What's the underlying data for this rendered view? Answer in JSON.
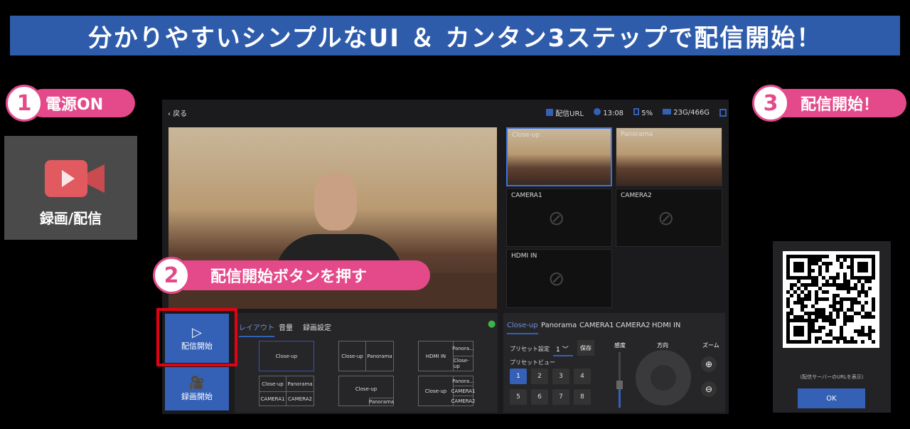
{
  "banner": {
    "title": "分かりやすいシンプルなUI ＆ カンタン3ステップで配信開始！"
  },
  "steps": [
    {
      "num": "1",
      "label": "電源ON"
    },
    {
      "num": "2",
      "label": "配信開始ボタンを押す"
    },
    {
      "num": "3",
      "label": "配信開始！"
    }
  ],
  "power_panel": {
    "label": "録画/配信",
    "icon": "video-camera-icon",
    "icon_color": "#e05a5f"
  },
  "app": {
    "back_label": "戻る",
    "status": {
      "stream_url": "配信URL",
      "time": "13:08",
      "battery": "5%",
      "storage": "23G/466G"
    },
    "tiles": [
      {
        "label": "Close-up",
        "selected": true
      },
      {
        "label": "Panorama"
      },
      {
        "label": "CAMERA1"
      },
      {
        "label": "CAMERA2"
      },
      {
        "label": "HDMI IN"
      }
    ],
    "buttons": {
      "stream": "配信開始",
      "record": "録画開始"
    },
    "layout_tabs": [
      "レイアウト",
      "音量",
      "録画設定"
    ],
    "layouts": {
      "single": "Close-up",
      "dual": [
        "Close-up",
        "Panorama"
      ],
      "hdmi": [
        "HDMI IN",
        "Panora...",
        "Close-up"
      ],
      "quad": [
        "Close-up",
        "Panorama",
        "CAMERA1",
        "CAMERA2"
      ],
      "pip": [
        "Close-up",
        "Panorama"
      ],
      "triple": [
        "Close-up",
        "Panora...",
        "CAMERA1",
        "CAMERA2"
      ]
    },
    "camera_tabs": [
      "Close-up",
      "Panorama",
      "CAMERA1",
      "CAMERA2",
      "HDMI IN"
    ],
    "preset": {
      "setting_label": "プリセット設定",
      "value": "1",
      "save": "保存",
      "view_label": "プリセットビュー",
      "buttons": [
        "1",
        "2",
        "3",
        "4",
        "5",
        "6",
        "7",
        "8"
      ],
      "active": "1"
    },
    "control": {
      "sensitivity": "感度",
      "direction": "方向",
      "zoom": "ズーム"
    },
    "accent": "#3460b6"
  },
  "phone": {
    "caption": "（配信サーバーのURLを表示）",
    "ok": "OK"
  }
}
